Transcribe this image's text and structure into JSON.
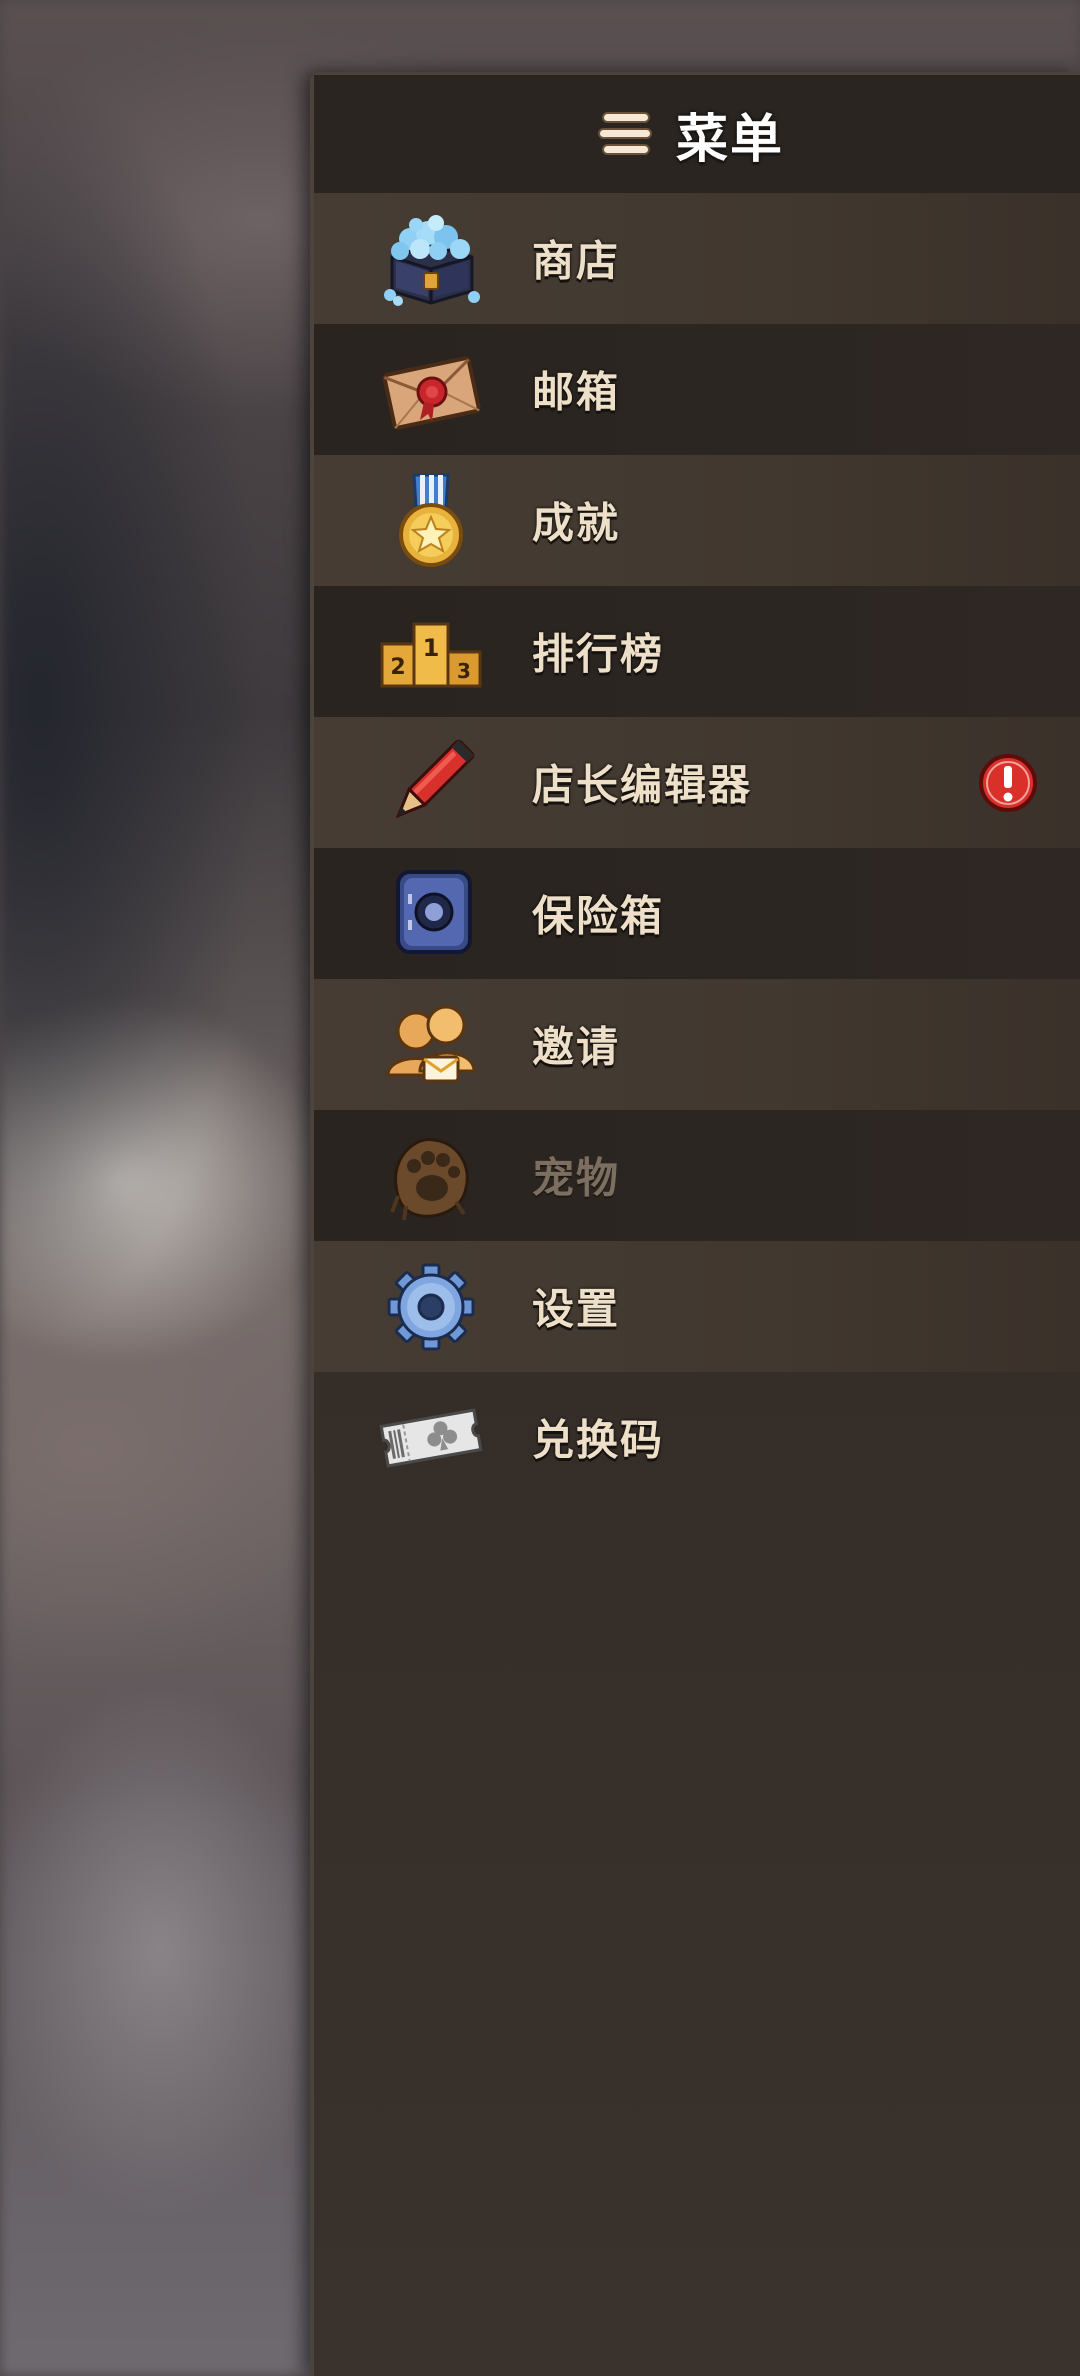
{
  "menu": {
    "title": "菜单",
    "items": [
      {
        "label": "商店",
        "icon": "gem-chest-icon",
        "badge": false,
        "disabled": false
      },
      {
        "label": "邮箱",
        "icon": "sealed-letter-icon",
        "badge": false,
        "disabled": false
      },
      {
        "label": "成就",
        "icon": "medal-icon",
        "badge": false,
        "disabled": false
      },
      {
        "label": "排行榜",
        "icon": "podium-icon",
        "badge": false,
        "disabled": false
      },
      {
        "label": "店长编辑器",
        "icon": "pencil-icon",
        "badge": true,
        "disabled": false
      },
      {
        "label": "保险箱",
        "icon": "safe-icon",
        "badge": false,
        "disabled": false
      },
      {
        "label": "邀请",
        "icon": "friends-invite-icon",
        "badge": false,
        "disabled": false
      },
      {
        "label": "宠物",
        "icon": "paw-icon",
        "badge": false,
        "disabled": true
      },
      {
        "label": "设置",
        "icon": "gear-icon",
        "badge": false,
        "disabled": false
      },
      {
        "label": "兑换码",
        "icon": "ticket-icon",
        "badge": false,
        "disabled": false
      }
    ]
  },
  "colors": {
    "label": "#eee0c8",
    "label_disabled": "#7c6f60",
    "alert_badge": "#d9302a"
  }
}
